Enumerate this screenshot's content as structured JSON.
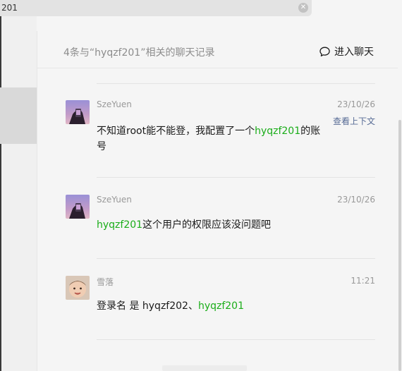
{
  "search": {
    "value": "201",
    "clear_icon": "close-circle-icon"
  },
  "header": {
    "title": "4条与“hyqzf201”相关的聊天记录",
    "enter_chat_label": "进入聊天",
    "enter_chat_icon": "chat-bubble-icon"
  },
  "colors": {
    "highlight": "#1aad19",
    "link": "#576b95",
    "meta": "#999999"
  },
  "messages": [
    {
      "sender": "SzeYuen",
      "date": "23/10/26",
      "context_link": "查看上下文",
      "text_before": "不知道root能不能登，我配置了一个",
      "highlight": "hyqzf201",
      "text_after": "的账号"
    },
    {
      "sender": "SzeYuen",
      "date": "23/10/26",
      "text_before": "",
      "highlight": "hyqzf201",
      "text_after": "这个用户的权限应该没问题吧"
    },
    {
      "sender": "雪落",
      "date": "11:21",
      "text_before": "登录名 是 hyqzf202、",
      "highlight": "hyqzf201",
      "text_after": ""
    }
  ]
}
